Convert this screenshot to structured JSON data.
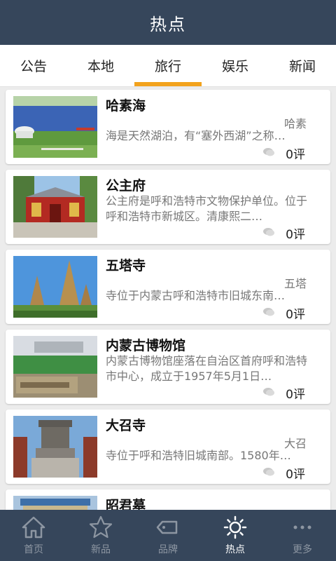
{
  "header": {
    "title": "热点"
  },
  "tabs": [
    {
      "label": "公告"
    },
    {
      "label": "本地"
    },
    {
      "label": "旅行",
      "active": true
    },
    {
      "label": "娱乐"
    },
    {
      "label": "新闻"
    }
  ],
  "accent_color": "#f2a21c",
  "header_color": "#36465b",
  "items": [
    {
      "title": "哈素海",
      "tag": "哈素",
      "desc": "海是天然湖泊，有“塞外西湖”之称…",
      "comments": "0评",
      "icon": "comment-icon"
    },
    {
      "title": "公主府",
      "tag": "",
      "desc": "公主府是呼和浩特市文物保护单位。位于呼和浩特市新城区。清康熙二…",
      "comments": "0评",
      "icon": "comment-icon"
    },
    {
      "title": "五塔寺",
      "tag": "五塔",
      "desc": "寺位于内蒙古呼和浩特市旧城东南…",
      "comments": "0评",
      "icon": "comment-icon"
    },
    {
      "title": "内蒙古博物馆",
      "tag": "",
      "desc": "内蒙古博物馆座落在自治区首府呼和浩特市中心，成立于1957年5月1日…",
      "comments": "0评",
      "icon": "comment-icon"
    },
    {
      "title": "大召寺",
      "tag": "大召",
      "desc": "寺位于呼和浩特旧城南部。1580年…",
      "comments": "0评",
      "icon": "comment-icon"
    },
    {
      "title": "昭君墓",
      "tag": "",
      "desc": "",
      "comments": "",
      "icon": "comment-icon"
    }
  ],
  "nav": [
    {
      "label": "首页",
      "icon": "home-icon"
    },
    {
      "label": "新品",
      "icon": "new-star-icon"
    },
    {
      "label": "品牌",
      "icon": "tag-icon"
    },
    {
      "label": "热点",
      "icon": "sun-icon",
      "active": true
    },
    {
      "label": "更多",
      "icon": "more-dots-icon"
    }
  ]
}
